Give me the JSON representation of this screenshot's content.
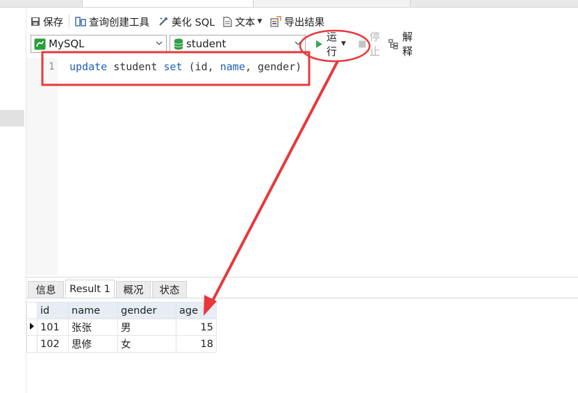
{
  "toolbar": {
    "save": "保存",
    "query_builder": "查询创建工具",
    "beautify_sql": "美化 SQL",
    "text": "文本",
    "export": "导出结果"
  },
  "connection": {
    "value": "MySQL"
  },
  "database": {
    "value": "student"
  },
  "run_controls": {
    "run": "运行",
    "stop": "停止",
    "explain": "解释"
  },
  "editor": {
    "line_number": "1",
    "code": {
      "kw1": "update",
      "t1": " student ",
      "kw2": "set",
      "t2": " (id, ",
      "kw3": "name",
      "t3": ", gender)"
    }
  },
  "result_tabs": [
    "信息",
    "Result 1",
    "概况",
    "状态"
  ],
  "result_table": {
    "columns": [
      "id",
      "name",
      "gender",
      "age"
    ],
    "rows": [
      [
        "101",
        "张张",
        "男",
        "15"
      ],
      [
        "102",
        "思修",
        "女",
        "18"
      ]
    ]
  },
  "colors": {
    "annotation": "#e8383b",
    "run_icon": "#3aa757",
    "db_icon": "#2f9e44"
  }
}
